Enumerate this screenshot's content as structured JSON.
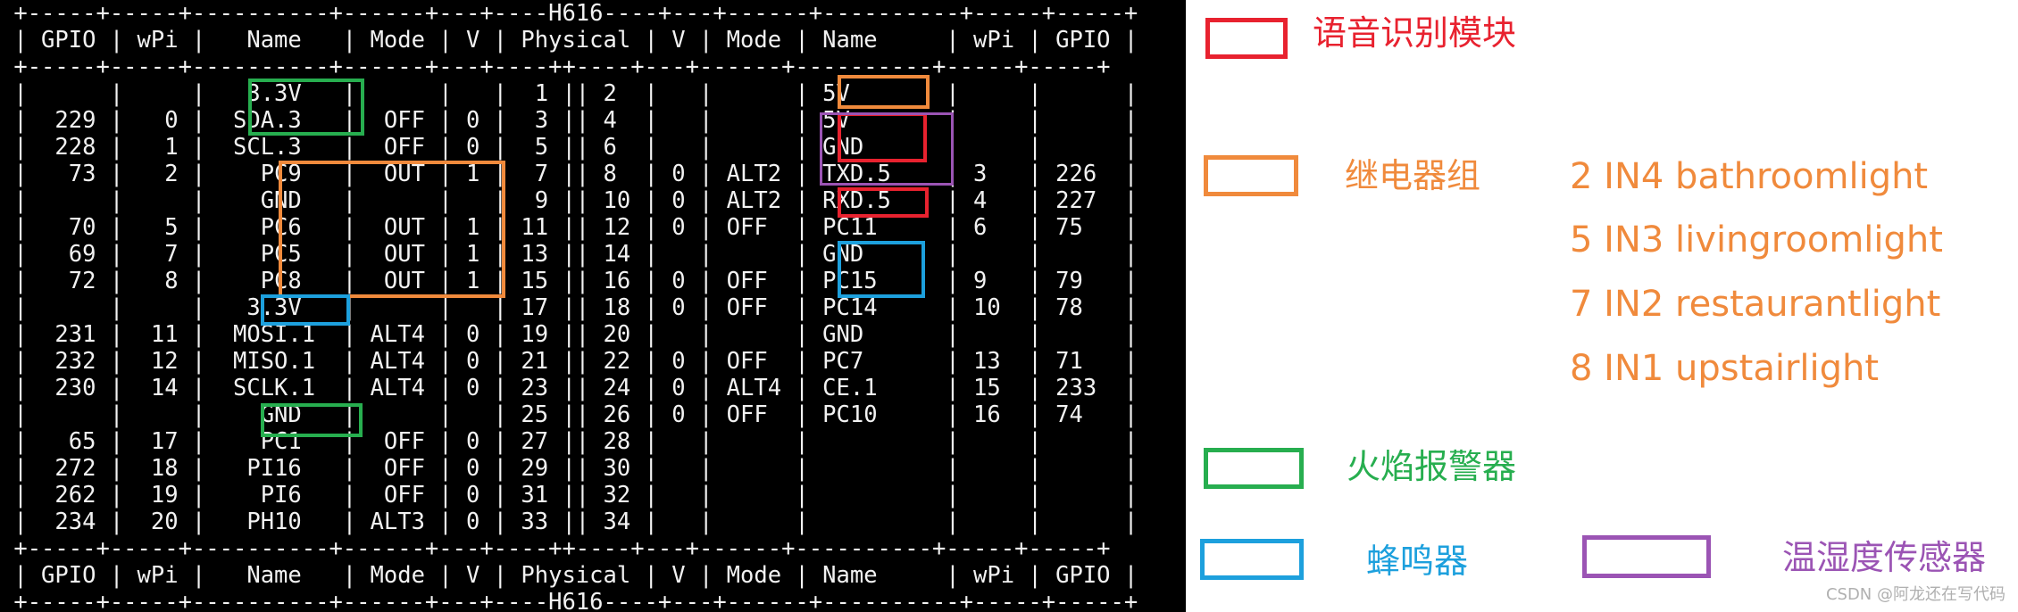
{
  "terminal": {
    "lines": [
      " +-----+-----+----------+------+---+----H616----+---+------+----------+-----+-----+",
      " | GPIO | wPi |   Name   | Mode | V | Physical | V | Mode | Name     | wPi | GPIO |",
      " +-----+-----+----------+------+---+----++----+---+------+----------+-----+-----+",
      " |      |     |   3.3V   |      |   |  1 || 2  |   |      | 5V       |     |      |",
      " |  229 |   0 |  SDA.3   |  OFF | 0 |  3 || 4  |   |      | 5V       |     |      |",
      " |  228 |   1 |  SCL.3   |  OFF | 0 |  5 || 6  |   |      | GND      |     |      |",
      " |   73 |   2 |    PC9   |  OUT | 1 |  7 || 8  | 0 | ALT2 | TXD.5    | 3   | 226  |",
      " |      |     |    GND   |      |   |  9 || 10 | 0 | ALT2 | RXD.5    | 4   | 227  |",
      " |   70 |   5 |    PC6   |  OUT | 1 | 11 || 12 | 0 | OFF  | PC11     | 6   | 75   |",
      " |   69 |   7 |    PC5   |  OUT | 1 | 13 || 14 |   |      | GND      |     |      |",
      " |   72 |   8 |    PC8   |  OUT | 1 | 15 || 16 | 0 | OFF  | PC15     | 9   | 79   |",
      " |      |     |   3.3V   |      |   | 17 || 18 | 0 | OFF  | PC14     | 10  | 78   |",
      " |  231 |  11 |  MOSI.1  | ALT4 | 0 | 19 || 20 |   |      | GND      |     |      |",
      " |  232 |  12 |  MISO.1  | ALT4 | 0 | 21 || 22 | 0 | OFF  | PC7      | 13  | 71   |",
      " |  230 |  14 |  SCLK.1  | ALT4 | 0 | 23 || 24 | 0 | ALT4 | CE.1     | 15  | 233  |",
      " |      |     |    GND   |      |   | 25 || 26 | 0 | OFF  | PC10     | 16  | 74   |",
      " |   65 |  17 |    PC1   |  OFF | 0 | 27 || 28 |   |      |          |     |      |",
      " |  272 |  18 |   PI16   |  OFF | 0 | 29 || 30 |   |      |          |     |      |",
      " |  262 |  19 |    PI6   |  OFF | 0 | 31 || 32 |   |      |          |     |      |",
      " |  234 |  20 |   PH10   | ALT3 | 0 | 33 || 34 |   |      |          |     |      |",
      " +-----+-----+----------+------+---+----++----+---+------+----------+-----+-----+",
      " | GPIO | wPi |   Name   | Mode | V | Physical | V | Mode | Name     | wPi | GPIO |",
      " +-----+-----+----------+------+---+----H616----+---+------+----------+-----+-----+"
    ]
  },
  "colors": {
    "red": "#e8222f",
    "orange": "#f08a3c",
    "green": "#27ae4f",
    "blue": "#1da0dd",
    "purple": "#9b54b4"
  },
  "legend": {
    "voice": "语音识别模块",
    "relay": "继电器组",
    "fire": "火焰报警器",
    "buzzer": "蜂鸣器",
    "sensor": "温湿度传感器"
  },
  "relay_notes": [
    "2 IN4 bathroomlight",
    "5 IN3 livingroomlight",
    "7 IN2 restaurantlight",
    "8 IN1 upstairlight"
  ],
  "watermark": "CSDN @阿龙还在写代码"
}
